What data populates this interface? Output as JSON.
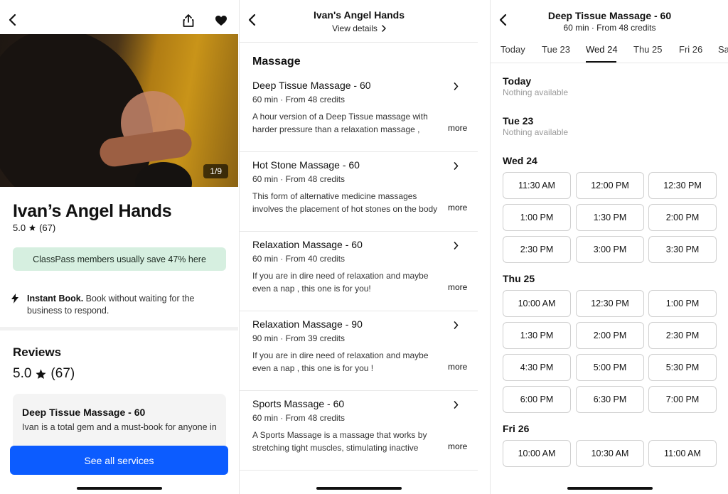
{
  "panel1": {
    "photo_counter": "1/9",
    "business_name": "Ivan’s Angel Hands",
    "rating": "5.0",
    "rating_count": "(67)",
    "savings_banner": "ClassPass members usually save 47% here",
    "instant_book_bold": "Instant Book.",
    "instant_book_text": " Book without waiting for the business to respond.",
    "reviews_heading": "Reviews",
    "reviews_score": "5.0",
    "reviews_count": "(67)",
    "review_card": {
      "title": "Deep Tissue Massage - 60",
      "excerpt": "Ivan is a total gem and a must-book for anyone in"
    },
    "cta_label": "See all services",
    "colors": {
      "banner_bg": "#d6efe0",
      "cta": "#0c5cff"
    },
    "icons": [
      "back-arrow-icon",
      "share-icon",
      "heart-icon",
      "star-icon",
      "lightning-icon"
    ]
  },
  "panel2": {
    "title": "Ivan's Angel Hands",
    "view_details": "View details",
    "section": "Massage",
    "services": [
      {
        "name": "Deep Tissue Massage - 60",
        "meta": "60 min · From 48 credits",
        "desc": "A hour version of a Deep Tissue massage with harder pressure than a relaxation massage , targeting knots",
        "more": "more"
      },
      {
        "name": "Hot Stone Massage - 60",
        "meta": "60 min · From 48 credits",
        "desc": "This form of alternative medicine massages involves the placement of hot stones on the body for the purpose",
        "more": "more"
      },
      {
        "name": "Relaxation Massage - 60",
        "meta": "60 min · From 40 credits",
        "desc": "If you are in dire need of relaxation and maybe even a nap , this one is for you! Class/service/experience details",
        "more": "more"
      },
      {
        "name": "Relaxation Massage - 90",
        "meta": "90 min · From 39 credits",
        "desc": "If you are in dire need of relaxation and maybe even a nap , this one is for you ! Class/service/experience details",
        "more": "more"
      },
      {
        "name": "Sports Massage - 60",
        "meta": "60 min · From 48 credits",
        "desc": "A Sports Massage is a massage that works by stretching tight muscles, stimulating inactive muscles and improving",
        "more": "more"
      }
    ]
  },
  "panel3": {
    "title": "Deep Tissue Massage - 60",
    "subtitle": "60 min · From 48 credits",
    "tabs": [
      "Today",
      "Tue 23",
      "Wed 24",
      "Thu 25",
      "Fri 26",
      "Sat"
    ],
    "active_tab": "Wed 24",
    "days": [
      {
        "label": "Today",
        "note": "Nothing available",
        "slots": []
      },
      {
        "label": "Tue 23",
        "note": "Nothing available",
        "slots": []
      },
      {
        "label": "Wed 24",
        "note": "",
        "slots": [
          "11:30 AM",
          "12:00 PM",
          "12:30 PM",
          "1:00 PM",
          "1:30 PM",
          "2:00 PM",
          "2:30 PM",
          "3:00 PM",
          "3:30 PM"
        ]
      },
      {
        "label": "Thu 25",
        "note": "",
        "slots": [
          "10:00 AM",
          "12:30 PM",
          "1:00 PM",
          "1:30 PM",
          "2:00 PM",
          "2:30 PM",
          "4:30 PM",
          "5:00 PM",
          "5:30 PM",
          "6:00 PM",
          "6:30 PM",
          "7:00 PM"
        ]
      },
      {
        "label": "Fri 26",
        "note": "",
        "slots": [
          "10:00 AM",
          "10:30 AM",
          "11:00 AM"
        ]
      }
    ]
  }
}
